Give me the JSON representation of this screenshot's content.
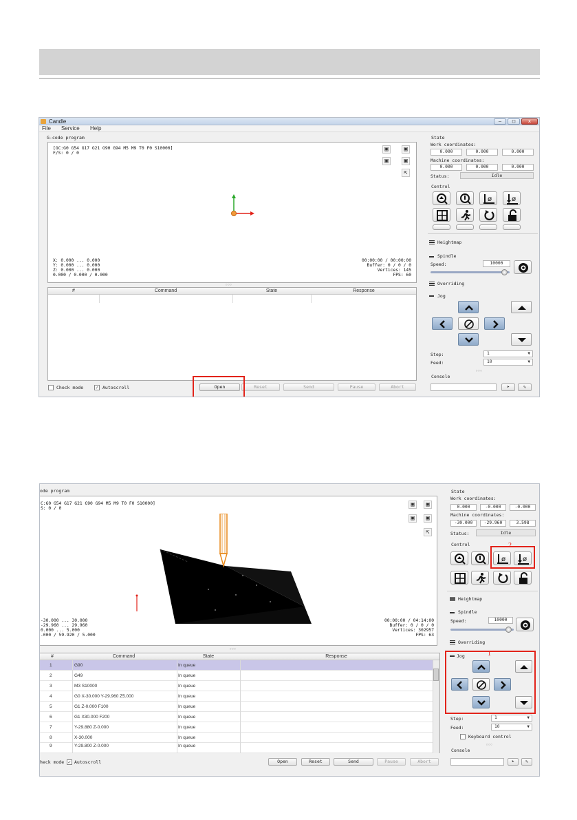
{
  "shot1": {
    "app_title": "Candle",
    "menu": [
      "File",
      "Service",
      "Help"
    ],
    "window_buttons": [
      "–",
      "□",
      "x"
    ],
    "gcode_label": "G-code program",
    "gcode_state": "[GC:G0 G54 G17 G21 G90 G94 M5 M9 T0 F0 S10000]",
    "fs": "F/S: 0 / 0",
    "coords": [
      "X: 0.000 ... 0.000",
      "Y: 0.000 ... 0.000",
      "Z: 0.000 ... 0.000",
      "0.000 / 0.000 / 0.000"
    ],
    "stats": [
      "00:00:00 / 00:00:00",
      "Buffer: 0 / 0 / 0",
      "Vertices: 145",
      "FPS: 60"
    ],
    "table_headers": [
      "#",
      "Command",
      "State",
      "Response"
    ],
    "check_mode": "Check mode",
    "autoscroll": "Autoscroll",
    "buttons": [
      "Open",
      "Reset",
      "Send",
      "Pause",
      "Abort"
    ],
    "state_label": "State",
    "work_coords_label": "Work coordinates:",
    "work_coords": [
      "0.000",
      "0.000",
      "0.000"
    ],
    "machine_coords_label": "Machine coordinates:",
    "machine_coords": [
      "0.000",
      "0.000",
      "0.000"
    ],
    "status_label": "Status:",
    "status_value": "Idle",
    "control_label": "Control",
    "heightmap_label": "Heightmap",
    "spindle_label": "Spindle",
    "speed_label": "Speed:",
    "speed_value": "10000",
    "overriding_label": "Overriding",
    "jog_label": "Jog",
    "step_label": "Step:",
    "step_value": "1",
    "feed_label": "Feed:",
    "feed_value": "10",
    "console_label": "Console"
  },
  "shot2": {
    "gcode_label": "ode program",
    "gcode_state": "C:G0 G54 G17 G21 G90 G94 M5 M9 T0 F0 S10000]",
    "fs": "S: 0 / 0",
    "coords": [
      "-30.000 ... 30.000",
      "-29.960 ... 29.960",
      "0.000 ... 5.000",
      ".000 / 59.920 / 5.000"
    ],
    "stats": [
      "00:00:00 / 04:14:00",
      "Buffer: 0 / 0 / 0",
      "Vertices: 302957",
      "FPS: 63"
    ],
    "table_headers": [
      "#",
      "Command",
      "State",
      "Response"
    ],
    "rows": [
      {
        "n": "1",
        "cmd": "G90",
        "state": "In queue"
      },
      {
        "n": "2",
        "cmd": "G49",
        "state": "In queue"
      },
      {
        "n": "3",
        "cmd": "M3 S10000",
        "state": "In queue"
      },
      {
        "n": "4",
        "cmd": "G0 X-30.000 Y-29.960 Z5.000",
        "state": "In queue"
      },
      {
        "n": "5",
        "cmd": "G1  Z-0.000 F100",
        "state": "In queue"
      },
      {
        "n": "6",
        "cmd": "G1 X30.000  F200",
        "state": "In queue"
      },
      {
        "n": "7",
        "cmd": "Y-29.880 Z-0.000",
        "state": "In queue"
      },
      {
        "n": "8",
        "cmd": "X-30.000",
        "state": "In queue"
      },
      {
        "n": "9",
        "cmd": "Y-29.800 Z-0.000",
        "state": "In queue"
      }
    ],
    "check_mode": "heck mode",
    "autoscroll": "Autoscroll",
    "buttons": [
      "Open",
      "Reset",
      "Send",
      "Pause",
      "Abort"
    ],
    "state_label": "State",
    "work_coords_label": "Work coordinates:",
    "work_coords": [
      "0.000",
      "-0.000",
      "-0.000"
    ],
    "machine_coords_label": "Machine coordinates:",
    "machine_coords": [
      "-30.000",
      "-29.960",
      "3.598"
    ],
    "status_label": "Status:",
    "status_value": "Idle",
    "control_label": "Control",
    "annotation_2": "2",
    "heightmap_label": "Heightmap",
    "spindle_label": "Spindle",
    "speed_label": "Speed:",
    "speed_value": "10000",
    "overriding_label": "Overriding",
    "jog_label": "Jog",
    "annotation_1": "1",
    "step_label": "Step:",
    "step_value": "1",
    "feed_label": "Feed:",
    "feed_value": "10",
    "keyboard_control": "Keyboard control",
    "console_label": "Console"
  },
  "colors": {
    "highlight_red": "#e2231a",
    "jog_blue": "#8faac9",
    "selected_row": "#c9c6e8"
  }
}
